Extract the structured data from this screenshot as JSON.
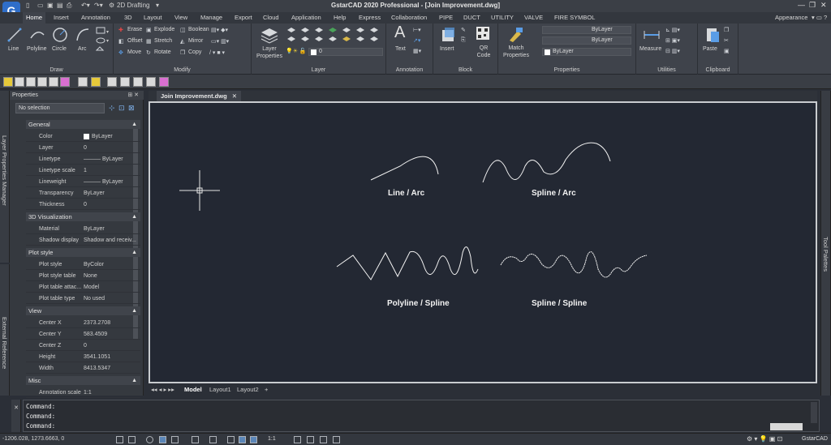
{
  "app": {
    "title": "GstarCAD 2020 Professional - [Join Improvement.dwg]",
    "workspace": "2D Drafting",
    "logo_letter": "G"
  },
  "menu_tabs": [
    "Home",
    "Insert",
    "Annotation",
    "3D",
    "Layout",
    "View",
    "Manage",
    "Export",
    "Cloud",
    "Application",
    "Help",
    "Express",
    "Collaboration",
    "PIPE",
    "DUCT",
    "UTILITY",
    "VALVE",
    "FIRE SYMBOL"
  ],
  "appearance_label": "Appearance",
  "ribbon": {
    "draw": {
      "title": "Draw",
      "tools": [
        "Line",
        "Polyline",
        "Circle",
        "Arc"
      ]
    },
    "modify": {
      "title": "Modify",
      "tools": [
        "Erase",
        "Explode",
        "Boolean",
        "Offset",
        "Stretch",
        "Mirror",
        "Move",
        "Rotate",
        "Copy"
      ]
    },
    "layer": {
      "title": "Layer",
      "big": "Layer Properties",
      "layer_value": "0"
    },
    "annotation": {
      "title": "Annotation",
      "big": "Text"
    },
    "block": {
      "title": "Block",
      "insert": "Insert",
      "qr": "QR Code"
    },
    "properties": {
      "title": "Properties",
      "match": "Match Properties",
      "values": [
        "ByLayer",
        "ByLayer",
        "ByLayer"
      ]
    },
    "utilities": {
      "title": "Utilities",
      "big": "Measure"
    },
    "clipboard": {
      "title": "Clipboard",
      "big": "Paste"
    }
  },
  "side_tabs": {
    "layer_manager": "Layer Properties Manager",
    "external_ref": "External Reference",
    "tool_palettes": "Tool Palettes"
  },
  "properties_panel": {
    "title": "Properties",
    "selection": "No selection",
    "sections": [
      {
        "name": "General",
        "rows": [
          [
            "Color",
            "ByLayer"
          ],
          [
            "Layer",
            "0"
          ],
          [
            "Linetype",
            "——— ByLayer"
          ],
          [
            "Linetype scale",
            "1"
          ],
          [
            "Lineweight",
            "——— ByLayer"
          ],
          [
            "Transparency",
            "ByLayer"
          ],
          [
            "Thickness",
            "0"
          ]
        ]
      },
      {
        "name": "3D Visualization",
        "rows": [
          [
            "Material",
            "ByLayer"
          ],
          [
            "Shadow display",
            "Shadow and receiv..."
          ]
        ]
      },
      {
        "name": "Plot style",
        "rows": [
          [
            "Plot style",
            "ByColor"
          ],
          [
            "Plot style table",
            "None"
          ],
          [
            "Plot table attac...",
            "Model"
          ],
          [
            "Plot table type",
            "No used"
          ]
        ]
      },
      {
        "name": "View",
        "rows": [
          [
            "Center X",
            "2373.2708"
          ],
          [
            "Center Y",
            "583.4509"
          ],
          [
            "Center Z",
            "0"
          ],
          [
            "Height",
            "3541.1051"
          ],
          [
            "Width",
            "8413.5347"
          ]
        ]
      },
      {
        "name": "Misc",
        "rows": [
          [
            "Annotation scale",
            "1:1"
          ]
        ]
      }
    ]
  },
  "document_tab": "Join Improvement.dwg",
  "drawing_labels": {
    "line_arc": "Line / Arc",
    "spline_arc": "Spline / Arc",
    "polyline_spline": "Polyline / Spline",
    "spline_spline": "Spline / Spline"
  },
  "layout_tabs": [
    "Model",
    "Layout1",
    "Layout2"
  ],
  "command_lines": [
    "Command:",
    "Command:",
    "Command:"
  ],
  "status": {
    "coordinates": "-1206.028, 1273.6663, 0",
    "scale": "1:1",
    "app_name": "GstarCAD"
  },
  "colors": {
    "canvas": "#232833",
    "ribbon": "#3f434b",
    "accent": "#2f6ec9"
  }
}
